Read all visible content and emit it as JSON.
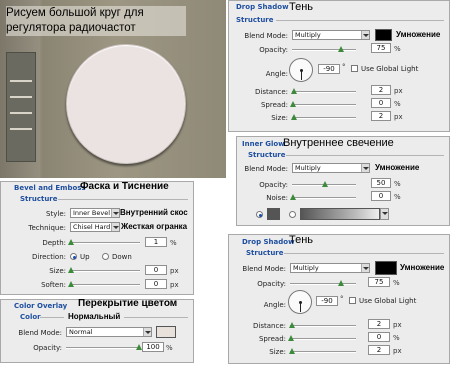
{
  "preview": {
    "caption": "Рисуем большой круг для регулятора радиочастот",
    "colors": {
      "base": "#908977",
      "circle": "#ebe3e1",
      "slot": "#6b6a60"
    }
  },
  "drop_shadow_top": {
    "title": "Drop Shadow",
    "ru_title": "Тень",
    "section": "Structure",
    "blend_label": "Blend Mode:",
    "blend_value": "Multiply",
    "blend_ru": "Умножение",
    "color": "#000000",
    "opacity_label": "Opacity:",
    "opacity": "75",
    "opacity_level": 75,
    "angle_label": "Angle:",
    "angle": "-90",
    "deg": "°",
    "global_light": "Use Global Light",
    "distance_label": "Distance:",
    "distance": "2",
    "spread_label": "Spread:",
    "spread": "0",
    "size_label": "Size:",
    "size": "2",
    "px": "px",
    "pct": "%"
  },
  "inner_glow": {
    "title": "Inner Glow",
    "ru_title": "Внутреннее свечение",
    "section": "Structure",
    "blend_label": "Blend Mode:",
    "blend_value": "Multiply",
    "blend_ru": "Умножение",
    "opacity_label": "Opacity:",
    "opacity": "50",
    "opacity_level": 50,
    "noise_label": "Noise:",
    "noise": "0",
    "pct": "%",
    "color": "#555555"
  },
  "bevel": {
    "title": "Bevel and Emboss",
    "ru_title": "Фаска и Тиснение",
    "section": "Structure",
    "style_label": "Style:",
    "style_value": "Inner Bevel",
    "style_ru": "Внутренний скос",
    "technique_label": "Technique:",
    "technique_value": "Chisel Hard",
    "technique_ru": "Жесткая огранка",
    "depth_label": "Depth:",
    "depth": "1",
    "direction_label": "Direction:",
    "dir_up": "Up",
    "dir_down": "Down",
    "size_label": "Size:",
    "size": "0",
    "soften_label": "Soften:",
    "soften": "0",
    "px": "px",
    "pct": "%"
  },
  "color_overlay": {
    "title": "Color Overlay",
    "ru_title": "Перекрытие цветом",
    "section": "Color",
    "blend_ru": "Нормальный",
    "blend_label": "Blend Mode:",
    "blend_value": "Normal",
    "color": "#e8e0db",
    "opacity_label": "Opacity:",
    "opacity": "100",
    "pct": "%"
  },
  "drop_shadow_bottom": {
    "title": "Drop Shadow",
    "ru_title": "Тень",
    "section": "Structure",
    "blend_label": "Blend Mode:",
    "blend_value": "Multiply",
    "blend_ru": "Умножение",
    "color": "#000000",
    "opacity_label": "Opacity:",
    "opacity": "75",
    "opacity_level": 75,
    "angle_label": "Angle:",
    "angle": "-90",
    "deg": "°",
    "global_light": "Use Global Light",
    "distance_label": "Distance:",
    "distance": "2",
    "spread_label": "Spread:",
    "spread": "0",
    "size_label": "Size:",
    "size": "2",
    "px": "px",
    "pct": "%"
  }
}
